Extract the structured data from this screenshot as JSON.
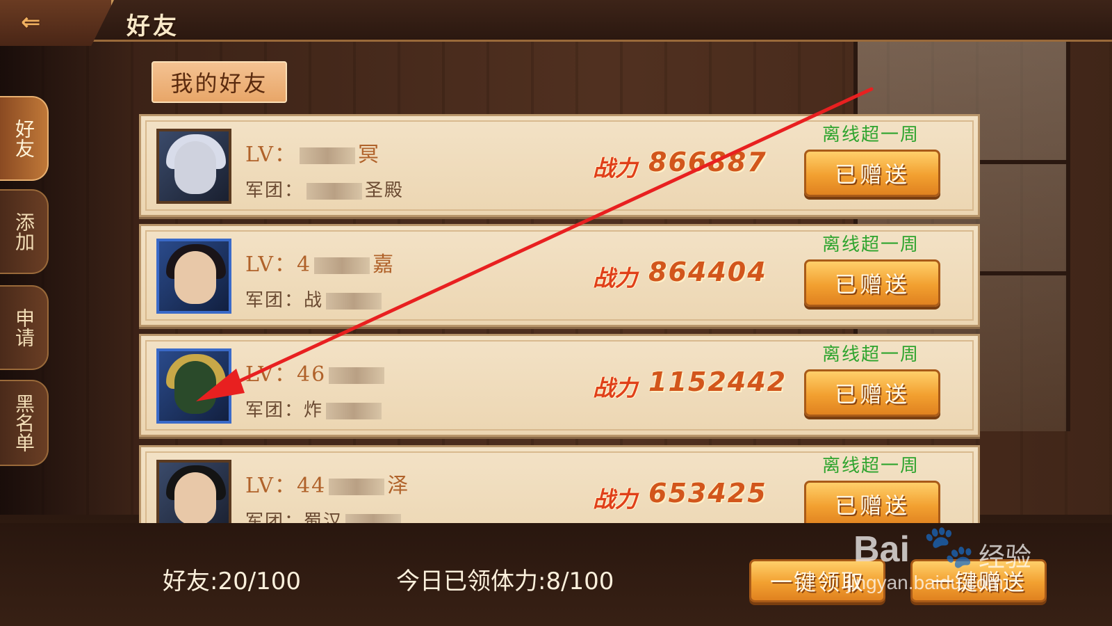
{
  "header": {
    "title": "好友",
    "back_icon": "back-arrow-icon"
  },
  "side_tabs": [
    {
      "label": "好友",
      "active": true
    },
    {
      "label": "添加",
      "active": false
    },
    {
      "label": "申请",
      "active": false
    },
    {
      "label": "黑名单",
      "active": false
    }
  ],
  "section": {
    "label": "我的好友"
  },
  "friends": [
    {
      "lv_prefix": "LV：",
      "name_visible": "冥",
      "legion_prefix": "军团：",
      "legion_visible": "圣殿",
      "power_label": "战力",
      "power": "866887",
      "status": "离线超一周",
      "button": "已赠送"
    },
    {
      "lv_prefix": "LV：",
      "lv_visible": "4",
      "name_visible": "嘉",
      "legion_prefix": "军团：",
      "legion_visible": "战",
      "power_label": "战力",
      "power": "864404",
      "status": "离线超一周",
      "button": "已赠送"
    },
    {
      "lv_prefix": "LV：",
      "lv_visible": "46",
      "legion_prefix": "军团：",
      "legion_visible": "炸",
      "power_label": "战力",
      "power": "1152442",
      "status": "离线超一周",
      "button": "已赠送"
    },
    {
      "lv_prefix": "LV：",
      "lv_visible": "44",
      "name_visible": "泽",
      "legion_prefix": "军团：",
      "legion_visible": "蜀汉",
      "power_label": "战力",
      "power": "653425",
      "status": "离线超一周",
      "button": "已赠送"
    }
  ],
  "footer": {
    "friend_count": "好友:20/100",
    "stamina": "今日已领体力:8/100",
    "collect_all": "一键领取",
    "gift_all": "一键赠送"
  },
  "watermark": {
    "logo": "Bai",
    "cn": "经验",
    "url": "jingyan.baidu.com"
  },
  "colors": {
    "accent": "#f2a030",
    "status_green": "#2ea42e",
    "power": "#d2561c",
    "annotation": "#e82020"
  }
}
